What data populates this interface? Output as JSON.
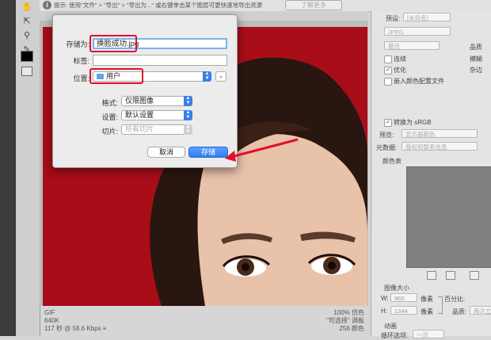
{
  "hint": {
    "text": "提示: 使用\"文件\" > \"导出\" > \"导出为...\" 或右键单击某个图层可更快速地导出资源",
    "more_button": "了解更多"
  },
  "image_status": {
    "format": "GIF",
    "size": "640K",
    "time": "117 秒 @ 56.6 Kbps ≡",
    "quality": "100% 仿色",
    "palette": "\"可选择\" 调板",
    "colors": "256 颜色"
  },
  "right_panel": {
    "preset_label": "预设:",
    "preset_value": "[未命名]",
    "format_value": "JPEG",
    "quality_value": "最佳",
    "quality_label": "品质",
    "blur_label": "模糊",
    "matte_label": "杂边",
    "progressive_label": "连续",
    "optimized_label": "优化",
    "embed_profile_label": "嵌入颜色配置文件",
    "srgb_label": "转换为 sRGB",
    "preview_label": "预览:",
    "preview_value": "显示器颜色",
    "metadata_label": "元数据:",
    "metadata_value": "版权和联系信息",
    "color_table_label": "颜色表",
    "image_size_label": "图像大小",
    "w_label": "W:",
    "w_value": "960",
    "h_label": "H:",
    "h_value": "1344",
    "unit": "像素",
    "percent_label": "百分比:",
    "quality2_label": "品质:",
    "quality2_value": "两次立方",
    "animation_label": "动画",
    "loop_label": "循环选项:",
    "loop_value": "一次"
  },
  "dialog": {
    "save_as_label": "存储为:",
    "filename": "换脸成功.jpg",
    "tags_label": "标签:",
    "location_label": "位置:",
    "location_value": "用户",
    "format_label": "格式:",
    "format_value": "仅限图像",
    "settings_label": "设置:",
    "settings_value": "默认设置",
    "slices_label": "切片:",
    "slices_value": "所有切片",
    "cancel_label": "取消",
    "save_label": "存储"
  },
  "accent_colors": {
    "annotation_red": "#e0102a",
    "primary_blue": "#2f7cf0",
    "photo_red": "#a80d18"
  }
}
